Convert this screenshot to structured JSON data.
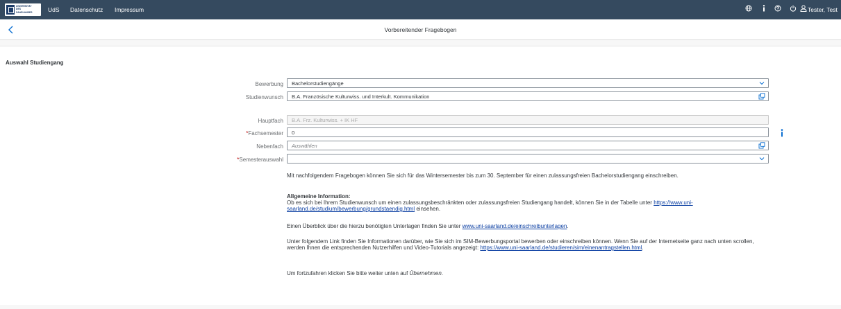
{
  "shell": {
    "logo_text": "UNIVERSITÄT\nDES\nSAARLANDES",
    "nav": [
      "UdS",
      "Datenschutz",
      "Impressum"
    ],
    "icons": [
      "globe-icon",
      "info-icon",
      "help-icon",
      "power-icon",
      "user-icon"
    ],
    "user": "Tester, Test"
  },
  "page": {
    "title": "Vorbereitender Fragebogen",
    "section_title": "Auswahl Studiengang"
  },
  "form": {
    "bewerbung": {
      "label": "Bewerbung",
      "value": "Bachelorstudiengänge"
    },
    "studienwunsch": {
      "label": "Studienwunsch",
      "value": "B.A. Französische Kulturwiss. und Interkult. Kommunikation"
    },
    "hauptfach": {
      "label": "Hauptfach",
      "value": "B.A. Frz. Kulturwiss. + IK HF"
    },
    "fachsemester": {
      "label": "Fachsemester",
      "value": "0"
    },
    "nebenfach": {
      "label": "Nebenfach",
      "placeholder": "Auswählen"
    },
    "semesterauswahl": {
      "label": "Semesterauswahl",
      "value": ""
    }
  },
  "info": {
    "p1": "Mit nachfolgendem Fragebogen können Sie sich für das Wintersemester bis zum 30. September für einen zulassungsfreien Bachelorstudiengang einschreiben.",
    "heading": "Allgemeine Information:",
    "p2a": "Ob es sich bei Ihrem Studienwunsch um einen zulassungsbeschränkten oder zulassungsfreien Studiengang handelt, können Sie in der Tabelle unter",
    "p2_link": "https://www.uni-saarland.de/studium/bewerbung/grundstaendig.html",
    "p2b": "einsehen.",
    "p3a": "Einen Überblick über die hierzu benötigten Unterlagen finden Sie unter",
    "p3_link": "www.uni-saarland.de/einschreibunterlagen",
    "p3b": ".",
    "p4a": "Unter folgendem Link finden Sie Informationen darüber, wie Sie sich im SIM-Bewerbungsportal bewerben oder einschreiben können. Wenn Sie auf der Internetseite ganz nach unten scrollen, werden Ihnen die entsprechenden Nutzerhilfen und Video-Tutorials angezeigt:",
    "p4_link": "https://www.uni-saarland.de/studieren/sim/einenantragstellen.html",
    "p4b": ".",
    "p5a": "Um fortzufahren klicken Sie bitte weiter unten auf",
    "p5_em": "Übernehmen",
    "p5b": "."
  }
}
